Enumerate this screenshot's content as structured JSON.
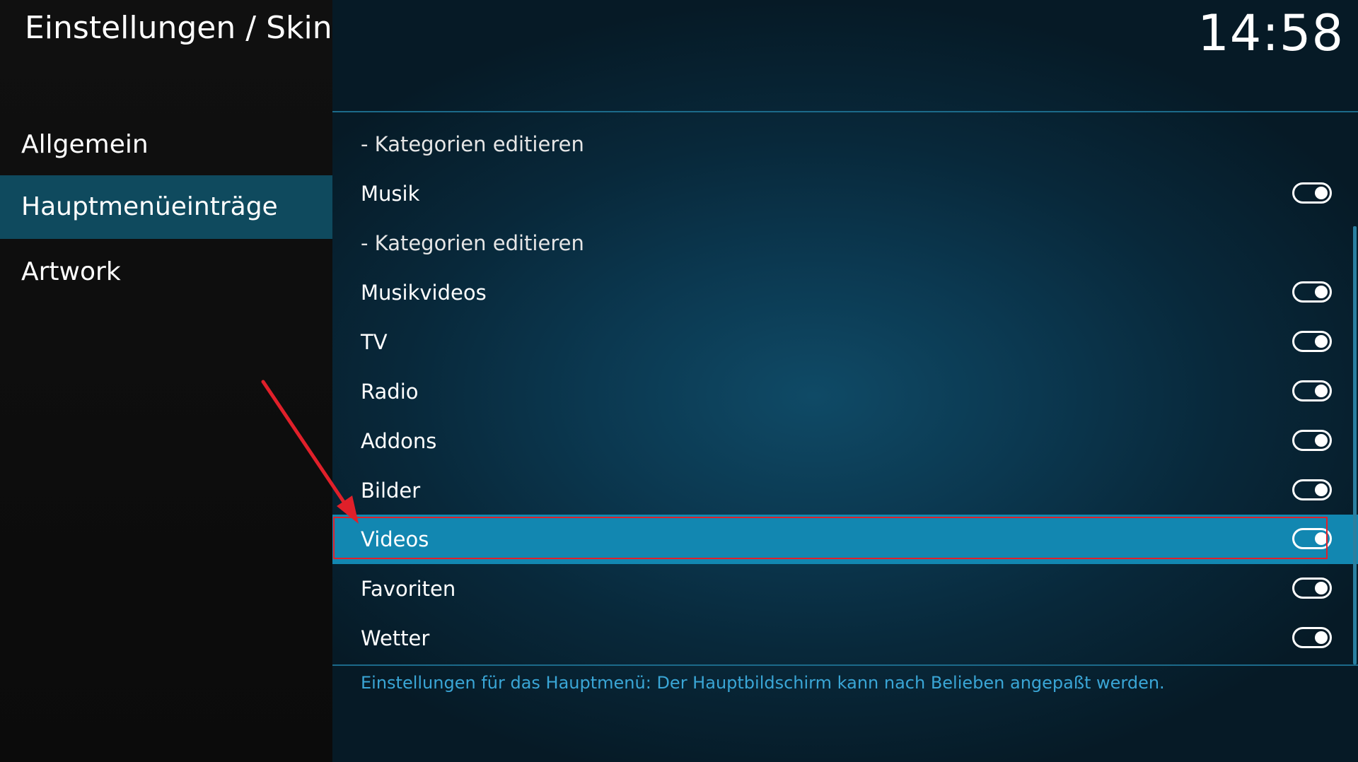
{
  "header": {
    "title": "Einstellungen / Skin",
    "clock": "14:58"
  },
  "sidebar": {
    "items": [
      {
        "label": "Allgemein",
        "active": false
      },
      {
        "label": "Hauptmenüeinträge",
        "active": true
      },
      {
        "label": "Artwork",
        "active": false
      }
    ]
  },
  "settings": {
    "rows": [
      {
        "label": "- Kategorien editieren",
        "toggle": null
      },
      {
        "label": "Musik",
        "toggle": true
      },
      {
        "label": "- Kategorien editieren",
        "toggle": null
      },
      {
        "label": "Musikvideos",
        "toggle": true
      },
      {
        "label": "TV",
        "toggle": true
      },
      {
        "label": "Radio",
        "toggle": true
      },
      {
        "label": "Addons",
        "toggle": true
      },
      {
        "label": "Bilder",
        "toggle": true
      },
      {
        "label": "Videos",
        "toggle": true,
        "selected": true
      },
      {
        "label": "Favoriten",
        "toggle": true
      },
      {
        "label": "Wetter",
        "toggle": true
      }
    ]
  },
  "description": "Einstellungen für das Hauptmenü: Der Hauptbildschirm kann nach Belieben angepaßt werden.",
  "colors": {
    "selection": "#1287b1",
    "sidebar_active": "#0f4a5e",
    "annotation": "#e0202a",
    "description_text": "#3aa6d6"
  }
}
